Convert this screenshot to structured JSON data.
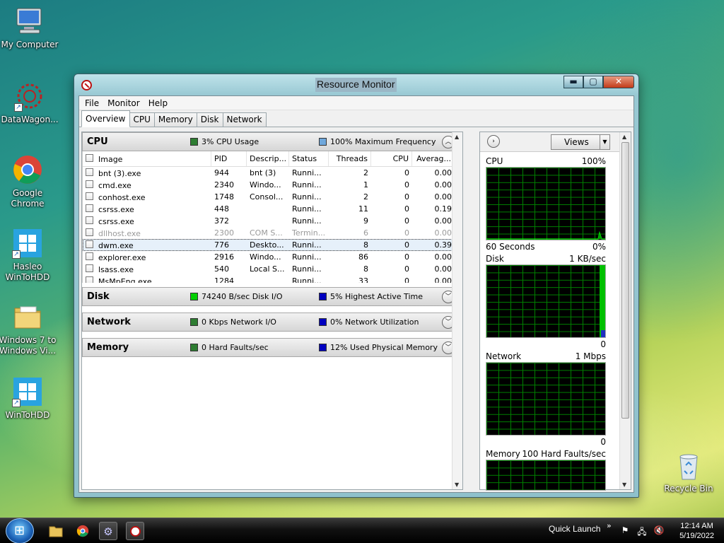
{
  "desktop": {
    "icons": [
      {
        "label": "My Computer",
        "icon": "computer-icon"
      },
      {
        "label": "DataWagon...",
        "icon": "datawagon-icon"
      },
      {
        "label": "Google Chrome",
        "icon": "chrome-icon"
      },
      {
        "label": "Hasleo WinToHDD",
        "icon": "wintohdd-icon"
      },
      {
        "label": "Windows 7 to Windows Vi...",
        "icon": "folder-icon"
      },
      {
        "label": "WinToHDD",
        "icon": "wintohdd-icon"
      },
      {
        "label": "Recycle Bin",
        "icon": "recycle-bin-icon"
      }
    ]
  },
  "window": {
    "title": "Resource Monitor",
    "menu": [
      "File",
      "Monitor",
      "Help"
    ],
    "tabs": [
      "Overview",
      "CPU",
      "Memory",
      "Disk",
      "Network"
    ],
    "active_tab": "Overview"
  },
  "cpu": {
    "title": "CPU",
    "usage": "3% CPU Usage",
    "frequency": "100% Maximum Frequency",
    "columns": [
      "Image",
      "PID",
      "Descrip...",
      "Status",
      "Threads",
      "CPU",
      "Averag..."
    ],
    "rows": [
      {
        "image": "bnt (3).exe",
        "pid": "944",
        "desc": "bnt (3)",
        "status": "Runni...",
        "threads": "2",
        "cpu": "0",
        "avg": "0.00"
      },
      {
        "image": "cmd.exe",
        "pid": "2340",
        "desc": "Windo...",
        "status": "Runni...",
        "threads": "1",
        "cpu": "0",
        "avg": "0.00"
      },
      {
        "image": "conhost.exe",
        "pid": "1748",
        "desc": "Consol...",
        "status": "Runni...",
        "threads": "2",
        "cpu": "0",
        "avg": "0.00"
      },
      {
        "image": "csrss.exe",
        "pid": "448",
        "desc": "",
        "status": "Runni...",
        "threads": "11",
        "cpu": "0",
        "avg": "0.19"
      },
      {
        "image": "csrss.exe",
        "pid": "372",
        "desc": "",
        "status": "Runni...",
        "threads": "9",
        "cpu": "0",
        "avg": "0.00"
      },
      {
        "image": "dllhost.exe",
        "pid": "2300",
        "desc": "COM S...",
        "status": "Termin...",
        "threads": "6",
        "cpu": "0",
        "avg": "0.00"
      },
      {
        "image": "dwm.exe",
        "pid": "776",
        "desc": "Deskto...",
        "status": "Runni...",
        "threads": "8",
        "cpu": "0",
        "avg": "0.39"
      },
      {
        "image": "explorer.exe",
        "pid": "2916",
        "desc": "Windo...",
        "status": "Runni...",
        "threads": "86",
        "cpu": "0",
        "avg": "0.00"
      },
      {
        "image": "lsass.exe",
        "pid": "540",
        "desc": "Local S...",
        "status": "Runni...",
        "threads": "8",
        "cpu": "0",
        "avg": "0.00"
      },
      {
        "image": "MsMpEng.exe",
        "pid": "1284",
        "desc": "",
        "status": "Runni...",
        "threads": "33",
        "cpu": "0",
        "avg": "0.00"
      }
    ]
  },
  "disk": {
    "title": "Disk",
    "io": "74240 B/sec Disk I/O",
    "active": "5% Highest Active Time"
  },
  "network": {
    "title": "Network",
    "io": "0 Kbps Network I/O",
    "util": "0% Network Utilization"
  },
  "memory": {
    "title": "Memory",
    "faults": "0 Hard Faults/sec",
    "used": "12% Used Physical Memory"
  },
  "graphs": {
    "views_label": "Views",
    "cpu": {
      "label": "CPU",
      "max": "100%",
      "foot_left": "60 Seconds",
      "foot_right": "0%"
    },
    "disk": {
      "label": "Disk",
      "max": "1 KB/sec",
      "foot_left": "",
      "foot_right": "0"
    },
    "network": {
      "label": "Network",
      "max": "1 Mbps",
      "foot_left": "",
      "foot_right": "0"
    },
    "memory": {
      "label": "Memory",
      "max": "100 Hard Faults/sec"
    }
  },
  "taskbar": {
    "quick_launch": "Quick Launch",
    "time": "12:14 AM",
    "date": "5/19/2022"
  },
  "colors": {
    "cpu_indicator": "#2e7d32",
    "frequency_indicator": "#6fa8dc",
    "disk_indicator": "#00d000",
    "blue_indicator": "#0000c0",
    "graph_grid": "#008000"
  }
}
